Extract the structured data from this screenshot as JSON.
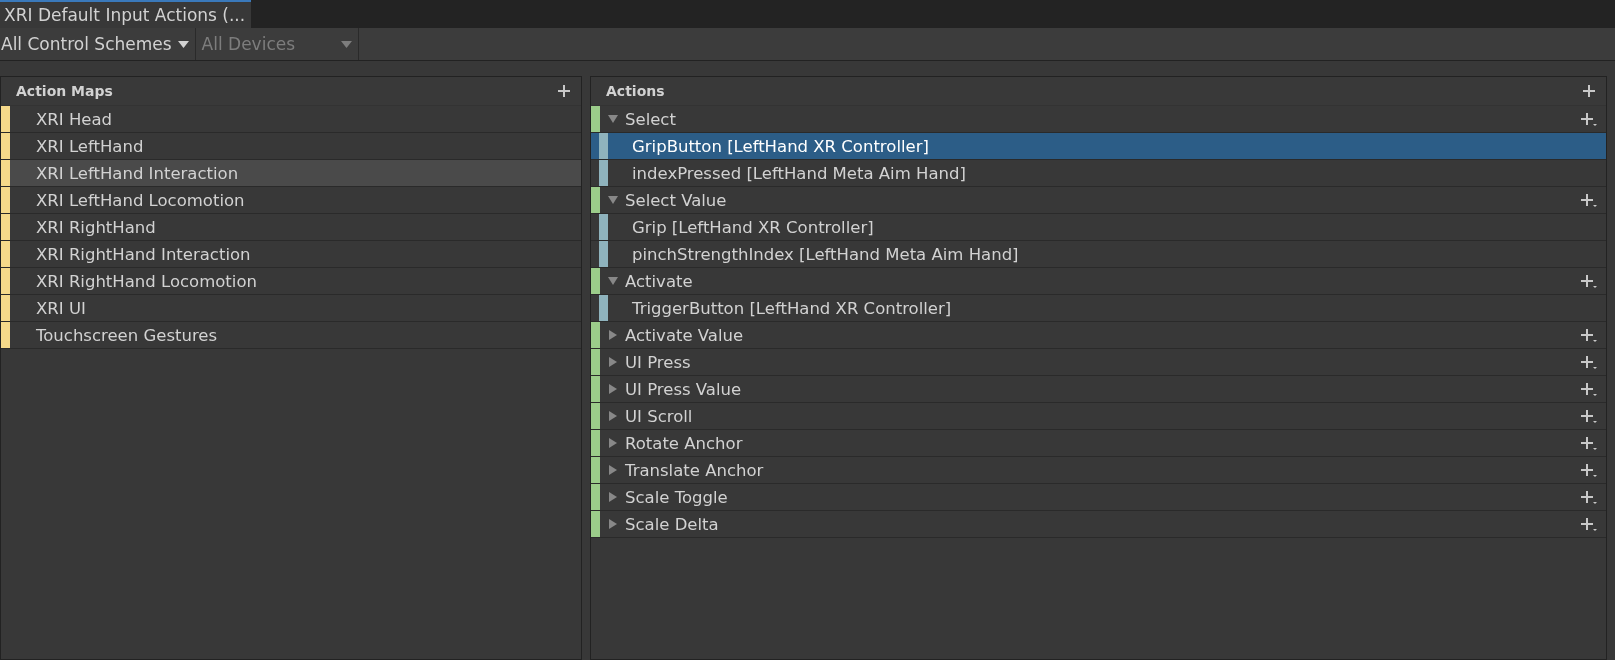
{
  "tab": {
    "title": "XRI Default Input Actions (...",
    "selected": true
  },
  "toolbar": {
    "control_scheme": "All Control Schemes",
    "devices": {
      "label": "All Devices",
      "disabled": true
    }
  },
  "action_maps": {
    "title": "Action Maps",
    "items": [
      {
        "label": "XRI Head",
        "selected": false
      },
      {
        "label": "XRI LeftHand",
        "selected": false
      },
      {
        "label": "XRI LeftHand Interaction",
        "selected": true
      },
      {
        "label": "XRI LeftHand Locomotion",
        "selected": false
      },
      {
        "label": "XRI RightHand",
        "selected": false
      },
      {
        "label": "XRI RightHand Interaction",
        "selected": false
      },
      {
        "label": "XRI RightHand Locomotion",
        "selected": false
      },
      {
        "label": "XRI UI",
        "selected": false
      },
      {
        "label": "Touchscreen Gestures",
        "selected": false
      }
    ]
  },
  "actions": {
    "title": "Actions",
    "items": [
      {
        "label": "Select",
        "expanded": true,
        "children": [
          {
            "label": "GripButton [LeftHand XR Controller]",
            "selected": true
          },
          {
            "label": "indexPressed [LeftHand Meta Aim Hand]",
            "selected": false
          }
        ]
      },
      {
        "label": "Select Value",
        "expanded": true,
        "children": [
          {
            "label": "Grip [LeftHand XR Controller]",
            "selected": false
          },
          {
            "label": "pinchStrengthIndex [LeftHand Meta Aim Hand]",
            "selected": false
          }
        ]
      },
      {
        "label": "Activate",
        "expanded": true,
        "children": [
          {
            "label": "TriggerButton [LeftHand XR Controller]",
            "selected": false
          }
        ]
      },
      {
        "label": "Activate Value",
        "expanded": false
      },
      {
        "label": "UI Press",
        "expanded": false
      },
      {
        "label": "UI Press Value",
        "expanded": false
      },
      {
        "label": "UI Scroll",
        "expanded": false
      },
      {
        "label": "Rotate Anchor",
        "expanded": false
      },
      {
        "label": "Translate Anchor",
        "expanded": false
      },
      {
        "label": "Scale Toggle",
        "expanded": false
      },
      {
        "label": "Scale Delta",
        "expanded": false
      }
    ]
  }
}
